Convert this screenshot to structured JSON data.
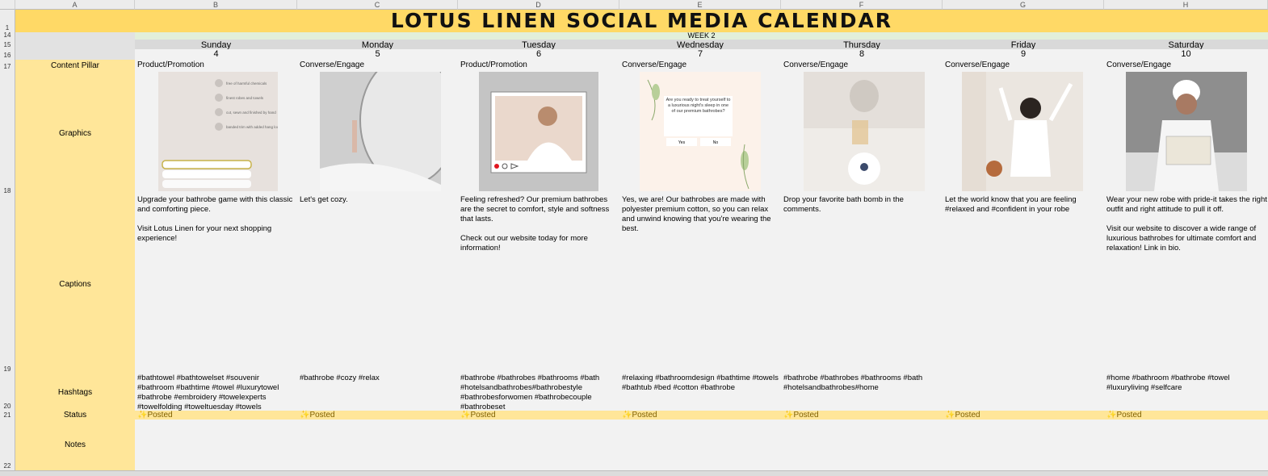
{
  "sheet": {
    "title": "LOTUS LINEN SOCIAL MEDIA CALENDAR",
    "week": "WEEK 2",
    "columns": [
      "A",
      "B",
      "C",
      "D",
      "E",
      "F",
      "G",
      "H"
    ],
    "rows": [
      "1",
      "14",
      "15",
      "16",
      "17",
      "18",
      "19",
      "20",
      "21",
      "22"
    ],
    "labels": {
      "pillar": "Content Pillar",
      "graphics": "Graphics",
      "captions": "Captions",
      "hashtags": "Hashtags",
      "status": "Status",
      "notes": "Notes"
    }
  },
  "days": [
    {
      "day": "Sunday",
      "date": "4",
      "pillar": "Product/Promotion",
      "caption": "Upgrade your bathrobe game with this classic and comforting piece.\n\nVisit Lotus Linen for your next shopping experience!",
      "hashtags": "#bathtowel #bathtowelset #souvenir #bathroom #bathtime #towel #luxurytowel #bathrobe #embroidery #towelexperts #towelfolding #toweltuesday #towels",
      "status": "✨Posted",
      "graphic": {
        "bg": "#e7e1dd",
        "list": [
          "free of harmful chemicals",
          "finest robes and towels",
          "cut, sewn and finished by hand",
          "banded trim with added hang loop for easy hanging"
        ]
      }
    },
    {
      "day": "Monday",
      "date": "5",
      "pillar": "Converse/Engage",
      "caption": "Let's get cozy.",
      "hashtags": "#bathrobe #cozy #relax",
      "status": "✨Posted",
      "graphic": {
        "bg": "#cfcfcf"
      }
    },
    {
      "day": "Tuesday",
      "date": "6",
      "pillar": "Product/Promotion",
      "caption": "Feeling refreshed? Our premium bathrobes are the secret to comfort, style and softness that lasts.\n\nCheck out our website today for more information!",
      "hashtags": "#bathrobe #bathrobes #bathrooms #bath #hotelsandbathrobes#bathrobestyle #bathrobesforwomen #bathrobecouple #bathrobeset",
      "status": "✨Posted",
      "graphic": {
        "bg": "#c4c4c4"
      }
    },
    {
      "day": "Wednesday",
      "date": "7",
      "pillar": "Converse/Engage",
      "caption": "Yes, we are! Our bathrobes are made with polyester premium cotton, so you can relax and unwind knowing that you're wearing the best.",
      "hashtags": "#relaxing #bathroomdesign #bathtime #towels #bathtub #bed #cotton #bathrobe",
      "status": "✨Posted",
      "graphic": {
        "bg": "#fcf2ea",
        "question": "Are you ready to treat yourself to a luxurious night's sleep in one of our premium bathrobes?",
        "yes": "Yes",
        "no": "No"
      }
    },
    {
      "day": "Thursday",
      "date": "8",
      "pillar": "Converse/Engage",
      "caption": "Drop your favorite bath bomb in the comments.",
      "hashtags": "#bathrobe #bathrobes #bathrooms #bath #hotelsandbathrobes#home",
      "status": "✨Posted",
      "graphic": {
        "bg": "#e4dfda"
      }
    },
    {
      "day": "Friday",
      "date": "9",
      "pillar": "Converse/Engage",
      "caption": "Let the world know that you are feeling #relaxed and #confident in your robe",
      "hashtags": "",
      "status": "✨Posted",
      "graphic": {
        "bg": "#ebe6e0"
      }
    },
    {
      "day": "Saturday",
      "date": "10",
      "pillar": "Converse/Engage",
      "caption": "Wear your new robe with pride-it takes the right outfit and right attitude to pull it off.\n\nVisit our website to discover a wide range of luxurious bathrobes for ultimate comfort and relaxation! Link in bio.",
      "hashtags": " #home #bathroom #bathrobe #towel #luxuryliving #selfcare",
      "status": "✨Posted",
      "graphic": {
        "bg": "#8e8e8e"
      }
    }
  ]
}
